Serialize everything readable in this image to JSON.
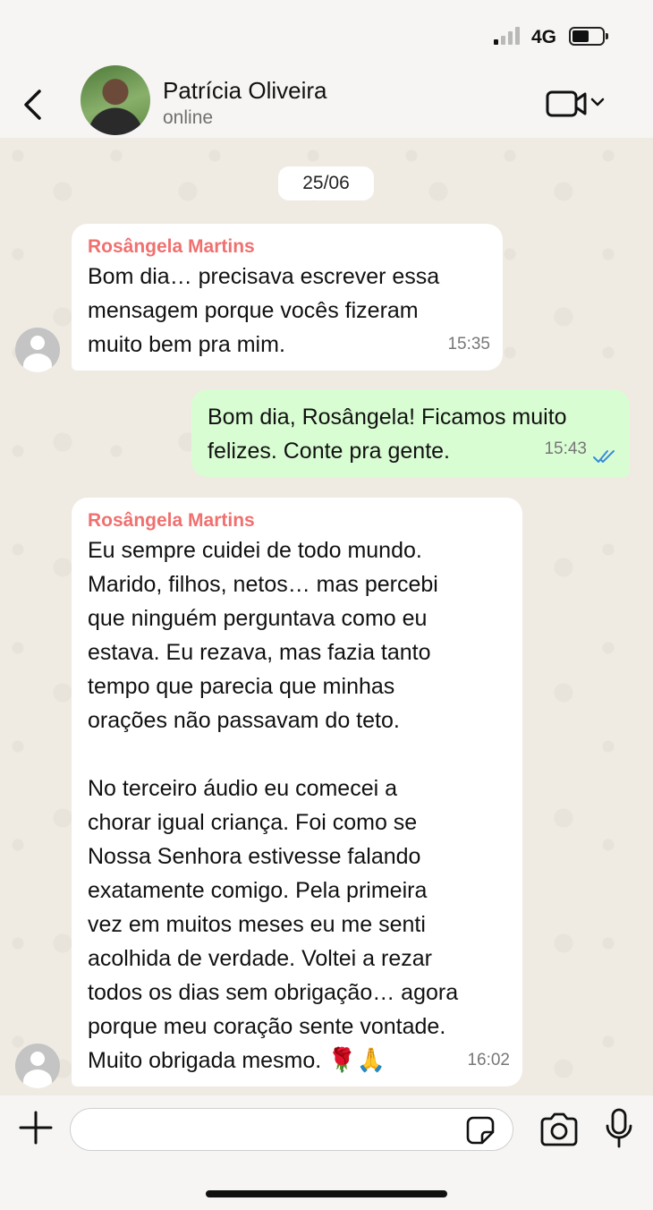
{
  "status_bar": {
    "network": "4G",
    "signal_bars_active": 1,
    "signal_bars_total": 4
  },
  "header": {
    "contact_name": "Patrícia Oliveira",
    "contact_status": "online",
    "back_icon": "chevron-left-icon",
    "video_icon": "video-camera-icon"
  },
  "chat": {
    "date_label": "25/06",
    "messages": [
      {
        "direction": "in",
        "sender": "Rosângela Martins",
        "text": "Bom dia… precisava escrever essa\nmensagem porque vocês fizeram\nmuito bem pra mim.",
        "time": "15:35"
      },
      {
        "direction": "out",
        "text": "Bom dia, Rosângela! Ficamos muito\nfelizes. Conte pra gente.",
        "time": "15:43",
        "read": true
      },
      {
        "direction": "in",
        "sender": "Rosângela Martins",
        "text": "Eu sempre cuidei de todo mundo.\nMarido, filhos, netos… mas percebi\nque ninguém perguntava como eu\nestava. Eu rezava, mas fazia tanto\ntempo que parecia que minhas\norações não passavam do teto.\n\nNo terceiro áudio eu comecei a\nchorar igual criança. Foi como se\nNossa Senhora estivesse falando\nexatamente comigo. Pela primeira\nvez em muitos meses eu me senti\nacolhida de verdade. Voltei a rezar\ntodos os dias sem obrigação… agora\nporque meu coração sente vontade.\nMuito obrigada mesmo.",
        "emoji": "🌹🙏",
        "time": "16:02"
      }
    ]
  },
  "composer": {
    "placeholder": "",
    "icons": [
      "plus-icon",
      "sticker-icon",
      "camera-icon",
      "microphone-icon"
    ]
  },
  "colors": {
    "sender_name": "#f0706f",
    "outgoing_bubble": "#d9fdd3",
    "read_ticks": "#3a8bd6",
    "chat_background": "#efeae2"
  }
}
